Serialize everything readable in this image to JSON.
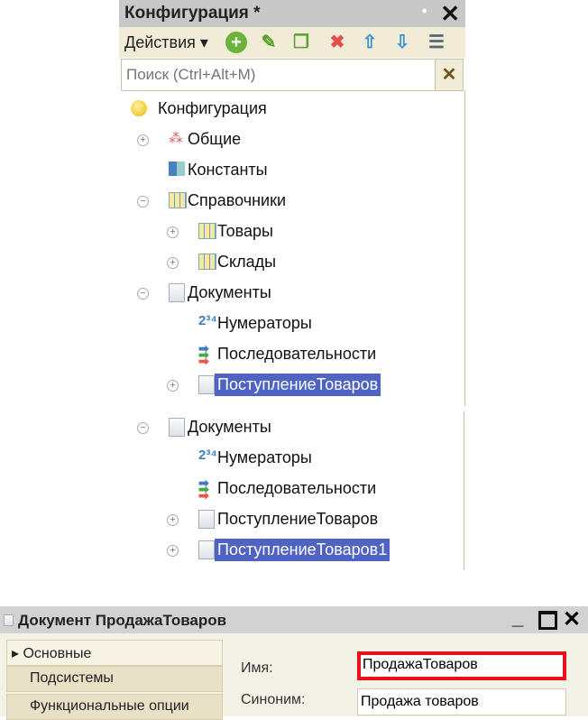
{
  "config_panel": {
    "title": "Конфигурация *",
    "actions_label": "Действия",
    "search_placeholder": "Поиск (Ctrl+Alt+M)",
    "toolbar_icons": [
      "add-icon",
      "edit-icon",
      "copy-icon",
      "delete-icon",
      "move-up-icon",
      "move-down-icon",
      "sort-icon"
    ],
    "tree": [
      {
        "label": "Конфигурация",
        "level": 0,
        "icon": "config-icon",
        "expander": "none"
      },
      {
        "label": "Общие",
        "level": 1,
        "icon": "common-icon",
        "expander": "plus"
      },
      {
        "label": "Константы",
        "level": 1,
        "icon": "constants-icon",
        "expander": "none"
      },
      {
        "label": "Справочники",
        "level": 1,
        "icon": "catalog-icon",
        "expander": "minus"
      },
      {
        "label": "Товары",
        "level": 2,
        "icon": "catalog-icon",
        "expander": "plus"
      },
      {
        "label": "Склады",
        "level": 2,
        "icon": "catalog-icon",
        "expander": "plus"
      },
      {
        "label": "Документы",
        "level": 1,
        "icon": "document-icon",
        "expander": "minus"
      },
      {
        "label": "Нумераторы",
        "level": 2,
        "icon": "numerator-icon",
        "expander": "none"
      },
      {
        "label": "Последовательности",
        "level": 2,
        "icon": "sequence-icon",
        "expander": "none"
      },
      {
        "label": "ПоступлениеТоваров",
        "level": 2,
        "icon": "document-icon",
        "expander": "plus",
        "selected": true
      }
    ]
  },
  "documents_panel": {
    "tree": [
      {
        "label": "Документы",
        "level": 1,
        "icon": "document-icon",
        "expander": "minus"
      },
      {
        "label": "Нумераторы",
        "level": 2,
        "icon": "numerator-icon",
        "expander": "none"
      },
      {
        "label": "Последовательности",
        "level": 2,
        "icon": "sequence-icon",
        "expander": "none"
      },
      {
        "label": "ПоступлениеТоваров",
        "level": 2,
        "icon": "document-icon",
        "expander": "plus"
      },
      {
        "label": "ПоступлениеТоваров1",
        "level": 2,
        "icon": "document-icon",
        "expander": "plus",
        "selected": true
      }
    ]
  },
  "document_window": {
    "title": "Документ ПродажаТоваров",
    "tabs": [
      "Основные",
      "Подсистемы",
      "Функциональные опции"
    ],
    "name_label": "Имя:",
    "name_value": "ПродажаТоваров",
    "synonym_label": "Синоним:",
    "synonym_value": "Продажа товаров"
  },
  "colors": {
    "selection": "#4f63c3",
    "highlight_border": "#e8101a"
  }
}
